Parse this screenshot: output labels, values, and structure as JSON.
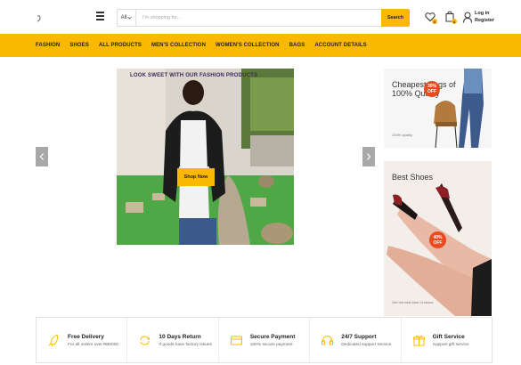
{
  "header": {
    "search": {
      "category": "All",
      "placeholder": "I'm shopping for...",
      "button_label": "Search"
    },
    "wishlist_count": "0",
    "cart_count": "0",
    "account": {
      "login_label": "Log in",
      "register_label": "Register"
    }
  },
  "nav": {
    "items": [
      "FASHION",
      "SHOES",
      "ALL PRODUCTS",
      "MEN'S COLLECTION",
      "WOMEN'S COLLECTION",
      "BAGS",
      "ACCOUNT DETAILS"
    ]
  },
  "slider": {
    "title": "LOOK SWEET WITH OUR FASHION PRODUCTS",
    "button_label": "Shop Now"
  },
  "banners": [
    {
      "title": "Cheapest Bags of 100% Quality",
      "subtitle": "100% quality",
      "badge_line1": "30%",
      "badge_line2": "OFF"
    },
    {
      "title": "Best Shoes",
      "subtitle": "Get the best kind of shoes",
      "badge_line1": "40%",
      "badge_line2": "OFF"
    }
  ],
  "features": [
    {
      "title": "Free Delivery",
      "subtitle": "For all orders over ₦30000"
    },
    {
      "title": "10 Days Return",
      "subtitle": "If goods have factory issues"
    },
    {
      "title": "Secure Payment",
      "subtitle": "100% secure payment"
    },
    {
      "title": "24/7 Support",
      "subtitle": "Dedicated support Service"
    },
    {
      "title": "Gift Service",
      "subtitle": "Support gift service"
    }
  ],
  "colors": {
    "accent": "#fbb800",
    "badge": "#ea4a1e",
    "text": "#222222"
  },
  "icons": [
    "menu-icon",
    "chevron-down-icon",
    "heart-icon",
    "cart-icon",
    "user-icon",
    "chevron-left-icon",
    "chevron-right-icon",
    "rocket-icon",
    "refresh-icon",
    "credit-card-icon",
    "headset-icon",
    "gift-icon"
  ]
}
